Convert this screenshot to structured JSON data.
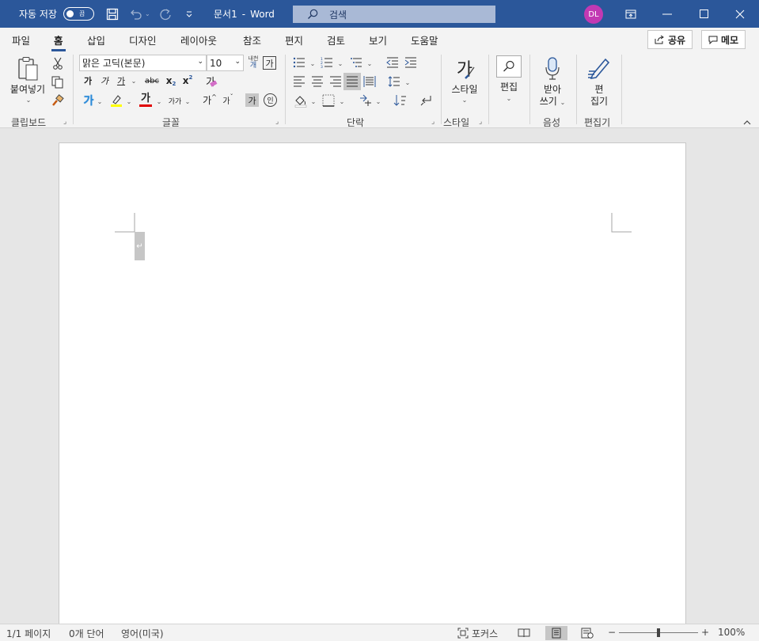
{
  "titlebar": {
    "autosave_label": "자동 저장",
    "autosave_state": "끔",
    "doc_name": "문서1",
    "separator": "-",
    "app_name": "Word",
    "search_placeholder": "검색",
    "avatar_initials": "DL",
    "accent": "#2b579a",
    "avatar_color": "#c239b3"
  },
  "tabs": [
    {
      "label": "파일"
    },
    {
      "label": "홈"
    },
    {
      "label": "삽입"
    },
    {
      "label": "디자인"
    },
    {
      "label": "레이아웃"
    },
    {
      "label": "참조"
    },
    {
      "label": "편지"
    },
    {
      "label": "검토"
    },
    {
      "label": "보기"
    },
    {
      "label": "도움말"
    }
  ],
  "active_tab": "홈",
  "share_label": "공유",
  "comments_label": "메모",
  "ribbon": {
    "clipboard": {
      "paste_label": "붙여넣기",
      "group_label": "클립보드"
    },
    "font": {
      "font_name": "맑은 고딕(본문)",
      "font_size": "10",
      "bold": "가",
      "italic": "가",
      "underline": "가",
      "strike": "abc",
      "subscript": "x",
      "subscript_mark": "2",
      "superscript": "x",
      "superscript_mark": "2",
      "clear_format": "가",
      "text_effect": "가",
      "font_color": "가",
      "char_size": "가가",
      "grow": "가",
      "shrink": "가",
      "phonetic": "내천",
      "phonetic_sub": "개",
      "char_border": "가",
      "shading": "가",
      "enclose": "인",
      "group_label": "글꼴"
    },
    "paragraph": {
      "group_label": "단락"
    },
    "styles": {
      "label": "스타일",
      "glyph": "가",
      "group_label": "스타일"
    },
    "editing": {
      "label": "편집"
    },
    "voice": {
      "label1": "받아",
      "label2": "쓰기",
      "group_label": "음성"
    },
    "editor": {
      "label1": "편",
      "label2": "집기",
      "group_label": "편집기"
    }
  },
  "document": {
    "paragraph_mark": "↵"
  },
  "statusbar": {
    "page": "1/1 페이지",
    "words": "0개 단어",
    "language": "영어(미국)",
    "focus": "포커스",
    "zoom_minus": "−",
    "zoom_plus": "+",
    "zoom": "100%",
    "zoom_fraction": 0.5
  }
}
